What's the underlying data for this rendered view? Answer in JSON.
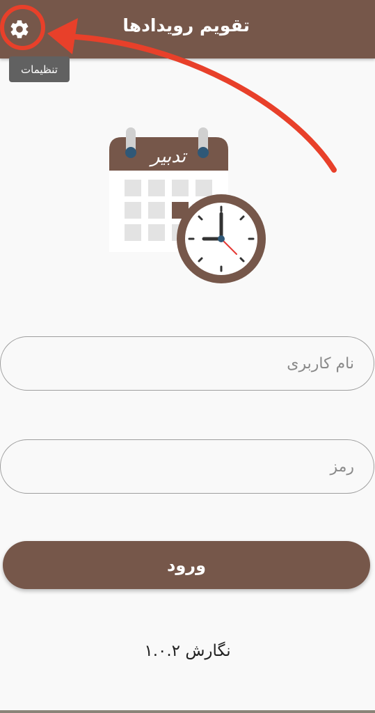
{
  "appbar": {
    "title": "تقویم رویدادها",
    "settings_icon": "gear-icon",
    "background_color": "#76574a"
  },
  "tooltip": {
    "text": "تنظیمات"
  },
  "logo": {
    "banner_text": "تدبیر",
    "icon": "calendar-clock-icon"
  },
  "form": {
    "username_placeholder": "نام کاربری",
    "username_value": "",
    "password_placeholder": "رمز",
    "password_value": "",
    "login_label": "ورود"
  },
  "footer": {
    "version_text": "نگارش ۱.۰.۲"
  },
  "annotation": {
    "color": "#e8402a"
  }
}
